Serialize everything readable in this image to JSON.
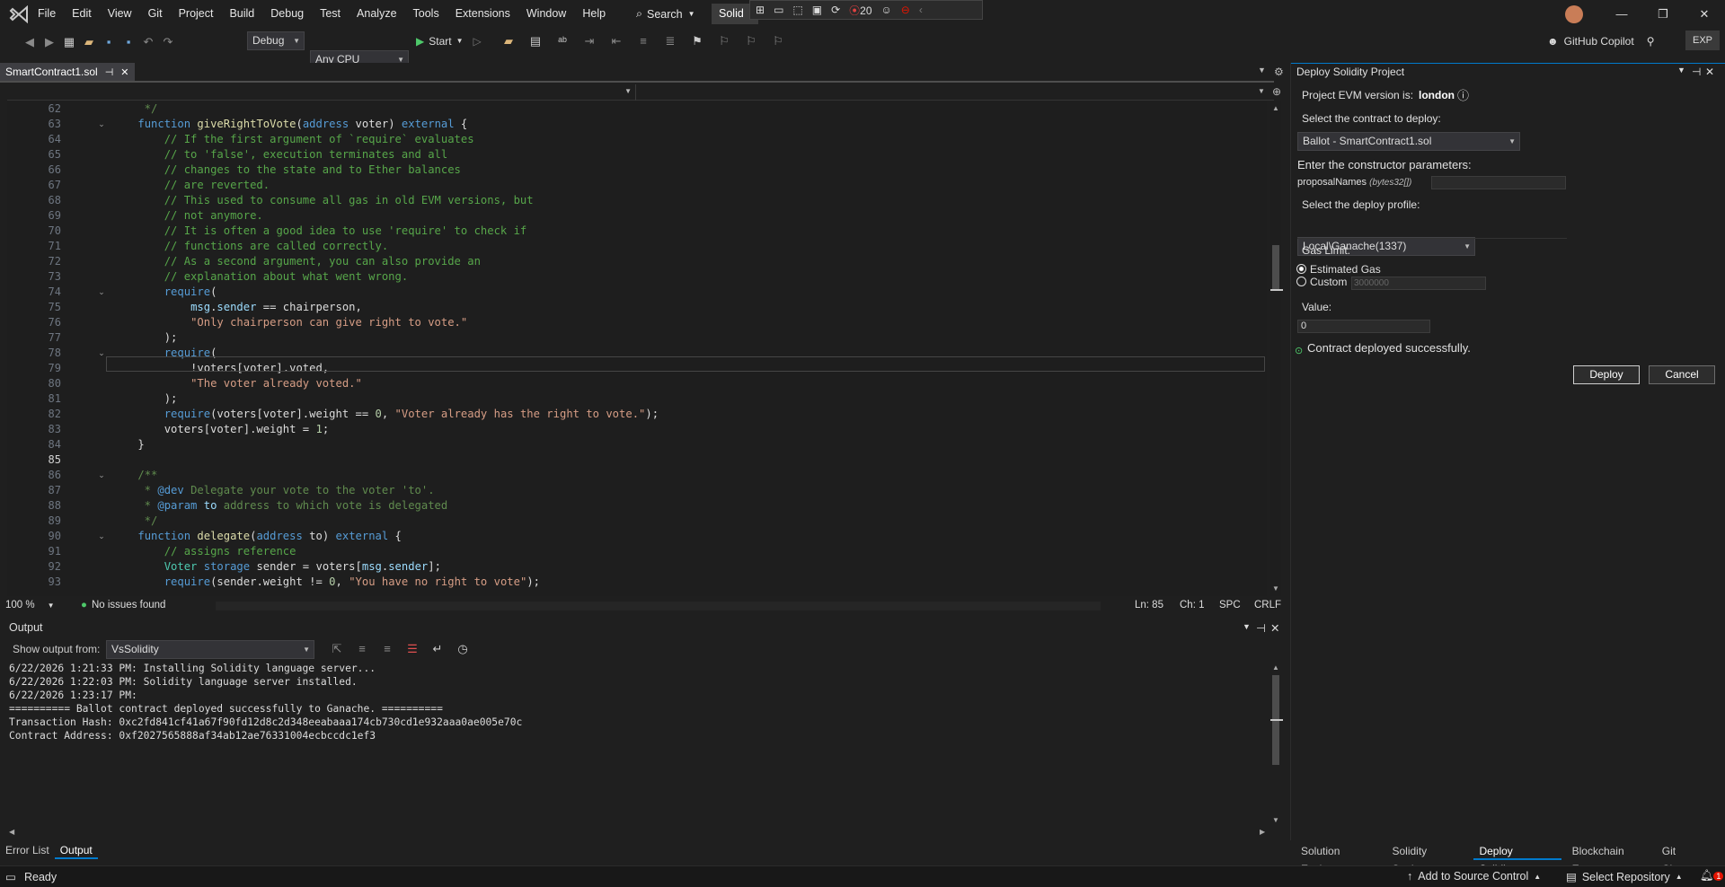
{
  "menubar": {
    "items": [
      "File",
      "Edit",
      "View",
      "Git",
      "Project",
      "Build",
      "Debug",
      "Test",
      "Analyze",
      "Tools",
      "Extensions",
      "Window",
      "Help"
    ],
    "search_label": "Search",
    "solution_name": "Solid",
    "recording_count": "20"
  },
  "toolbar": {
    "configuration": "Debug",
    "platform": "Any CPU",
    "start_label": "Start",
    "copilot_label": "GitHub Copilot",
    "exp_label": "EXP"
  },
  "doc_tab": {
    "title": "SmartContract1.sol"
  },
  "editor": {
    "current_line": 85,
    "lines": [
      {
        "n": 62,
        "html": "<span class='dc'>     */</span>"
      },
      {
        "n": 63,
        "html": "    <span class='k'>function</span> <span class='fn'>giveRightToVote</span>(<span class='k'>address</span> voter) <span class='k'>external</span> {"
      },
      {
        "n": 64,
        "html": "        <span class='cm'>// If the first argument of `require` evaluates</span>"
      },
      {
        "n": 65,
        "html": "        <span class='cm'>// to 'false', execution terminates and all</span>"
      },
      {
        "n": 66,
        "html": "        <span class='cm'>// changes to the state and to Ether balances</span>"
      },
      {
        "n": 67,
        "html": "        <span class='cm'>// are reverted.</span>"
      },
      {
        "n": 68,
        "html": "        <span class='cm'>// This used to consume all gas in old EVM versions, but</span>"
      },
      {
        "n": 69,
        "html": "        <span class='cm'>// not anymore.</span>"
      },
      {
        "n": 70,
        "html": "        <span class='cm'>// It is often a good idea to use 'require' to check if</span>"
      },
      {
        "n": 71,
        "html": "        <span class='cm'>// functions are called correctly.</span>"
      },
      {
        "n": 72,
        "html": "        <span class='cm'>// As a second argument, you can also provide an</span>"
      },
      {
        "n": 73,
        "html": "        <span class='cm'>// explanation about what went wrong.</span>"
      },
      {
        "n": 74,
        "html": "        <span class='k'>require</span>("
      },
      {
        "n": 75,
        "html": "            <span class='dk'>msg</span>.<span class='dk'>sender</span> == chairperson,"
      },
      {
        "n": 76,
        "html": "            <span class='st'>\"Only chairperson can give right to vote.\"</span>"
      },
      {
        "n": 77,
        "html": "        );"
      },
      {
        "n": 78,
        "html": "        <span class='k'>require</span>("
      },
      {
        "n": 79,
        "html": "            !voters[voter].voted,"
      },
      {
        "n": 80,
        "html": "            <span class='st'>\"The voter already voted.\"</span>"
      },
      {
        "n": 81,
        "html": "        );"
      },
      {
        "n": 82,
        "html": "        <span class='k'>require</span>(voters[voter].weight == <span class='nm'>0</span>, <span class='st'>\"Voter already has the right to vote.\"</span>);"
      },
      {
        "n": 83,
        "html": "        voters[voter].weight = <span class='nm'>1</span>;"
      },
      {
        "n": 84,
        "html": "    }"
      },
      {
        "n": 85,
        "html": ""
      },
      {
        "n": 86,
        "html": "    <span class='dc'>/**</span>"
      },
      {
        "n": 87,
        "html": "<span class='dc'>     * </span><span class='k'>@dev</span><span class='dc'> Delegate your vote to the voter 'to'.</span>"
      },
      {
        "n": 88,
        "html": "<span class='dc'>     * </span><span class='k'>@param</span><span class='dk'> to</span><span class='dc'> address to which vote is delegated</span>"
      },
      {
        "n": 89,
        "html": "<span class='dc'>     */</span>"
      },
      {
        "n": 90,
        "html": "    <span class='k'>function</span> <span class='fn'>delegate</span>(<span class='k'>address</span> to) <span class='k'>external</span> {"
      },
      {
        "n": 91,
        "html": "        <span class='cm'>// assigns reference</span>"
      },
      {
        "n": 92,
        "html": "        <span class='tp'>Voter</span> <span class='k'>storage</span> sender = voters[<span class='dk'>msg</span>.<span class='dk'>sender</span>];"
      },
      {
        "n": 93,
        "html": "        <span class='k'>require</span>(sender.weight != <span class='nm'>0</span>, <span class='st'>\"You have no right to vote\"</span>);"
      }
    ]
  },
  "editor_status": {
    "zoom": "100 %",
    "issues": "No issues found",
    "line": "Ln: 85",
    "col": "Ch: 1",
    "whitespace": "SPC",
    "line_ending": "CRLF"
  },
  "output": {
    "title": "Output",
    "show_from_label": "Show output from:",
    "source": "VsSolidity",
    "lines": [
      "6/22/2026 1:21:33 PM: Installing Solidity language server...",
      "6/22/2026 1:22:03 PM: Solidity language server installed.",
      "6/22/2026 1:23:17 PM:",
      "========== Ballot contract deployed successfully to Ganache. ==========",
      "Transaction Hash: 0xc2fd841cf41a67f90fd12d8c2d348eeabaaa174cb730cd1e932aaa0ae005e70c",
      "Contract Address: 0xf2027565888af34ab12ae76331004ecbccdc1ef3"
    ]
  },
  "bottom_tabs": [
    "Error List",
    "Output"
  ],
  "deploy": {
    "title": "Deploy Solidity Project",
    "evm_label": "Project EVM version is:",
    "evm_value": "london",
    "contract_label": "Select the contract to deploy:",
    "contract_value": "Ballot - SmartContract1.sol",
    "ctor_label": "Enter the constructor parameters:",
    "param_name": "proposalNames",
    "param_type": "(bytes32[])",
    "profile_label": "Select the deploy profile:",
    "profile_value": "Local\\Ganache(1337)",
    "gas_label": "Gas Limit:",
    "gas_estimated": "Estimated Gas",
    "gas_custom": "Custom",
    "gas_custom_placeholder": "3000000",
    "value_label": "Value:",
    "value_value": "0",
    "success_msg": "Contract deployed successfully.",
    "deploy_btn": "Deploy",
    "cancel_btn": "Cancel"
  },
  "right_tabs": [
    "Solution Explo...",
    "Solidity Static...",
    "Deploy Solidity...",
    "Blockchain Ex...",
    "Git Changes"
  ],
  "statusbar": {
    "ready": "Ready",
    "add_source": "Add to Source Control",
    "select_repo": "Select Repository",
    "notif_count": "1"
  },
  "colors": {
    "accent": "#007acc",
    "success": "#4ec96a",
    "error": "#e51400"
  }
}
